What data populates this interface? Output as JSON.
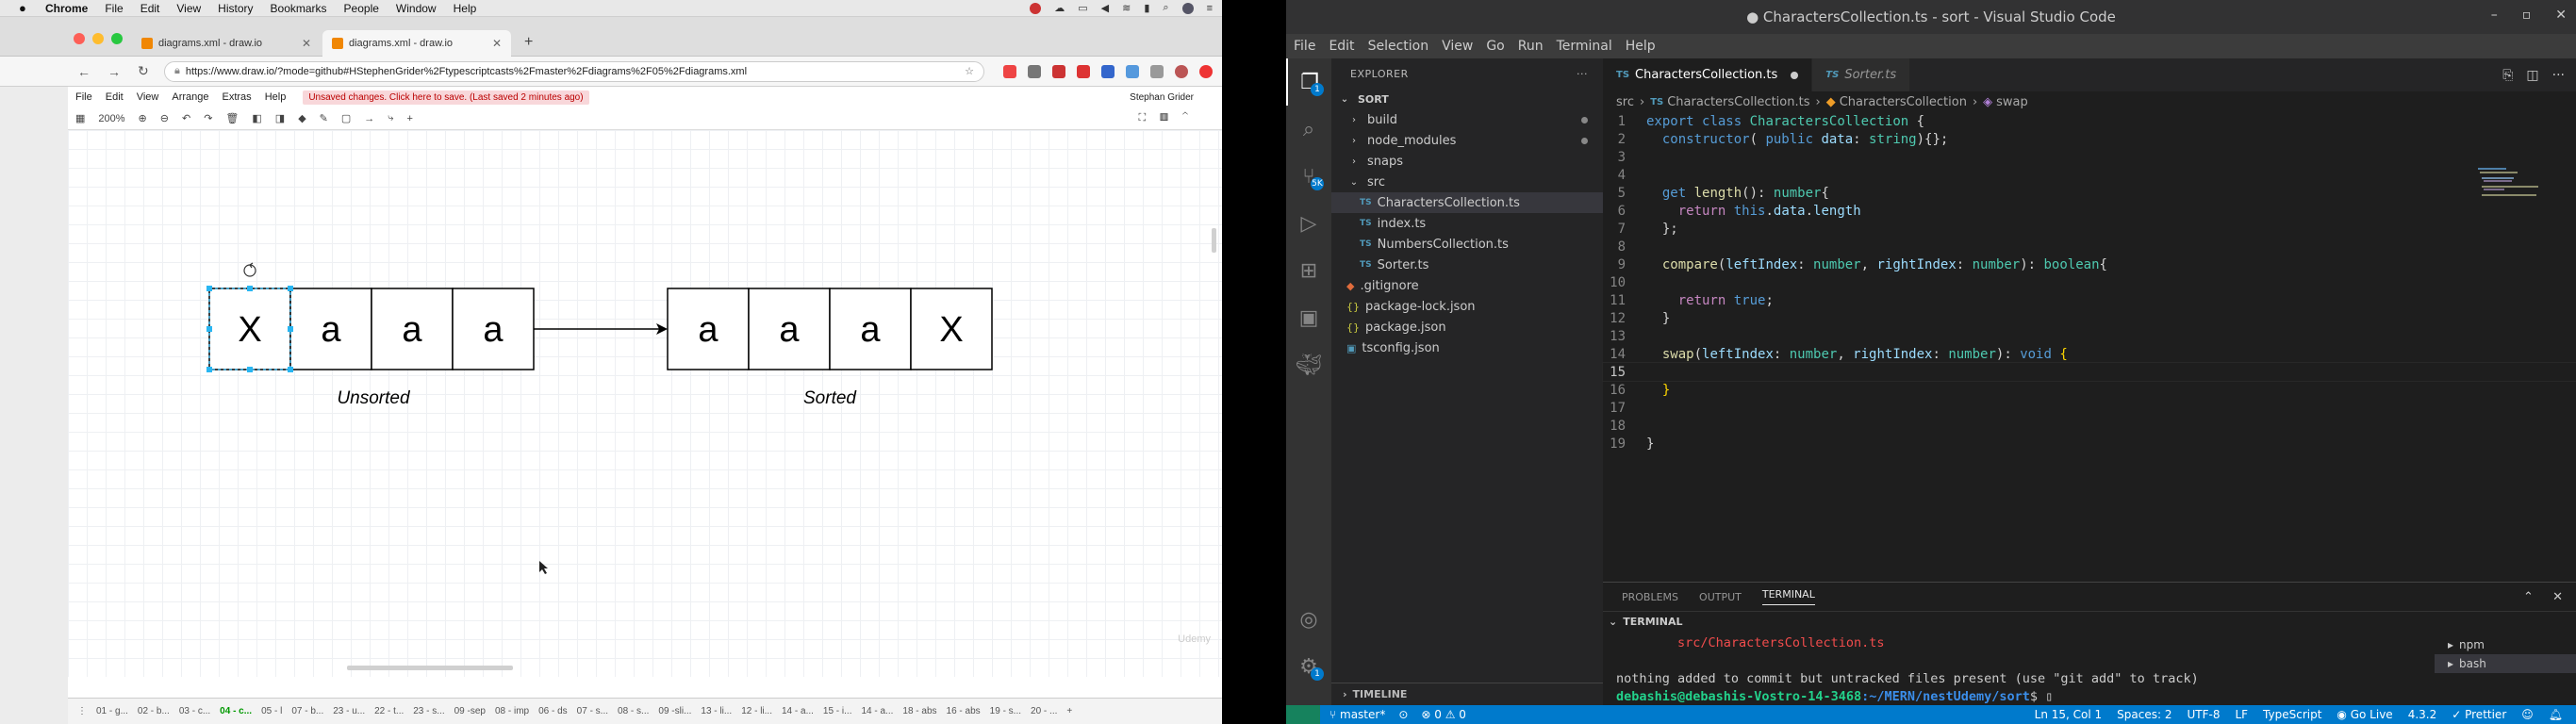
{
  "mac_menu": {
    "app": "Chrome",
    "items": [
      "File",
      "Edit",
      "View",
      "History",
      "Bookmarks",
      "People",
      "Window",
      "Help"
    ]
  },
  "chrome": {
    "tabs": [
      {
        "title": "diagrams.xml - draw.io"
      },
      {
        "title": "diagrams.xml - draw.io"
      }
    ],
    "new_tab": "+",
    "url": "https://www.draw.io/?mode=github#HStephenGrider%2Ftypescriptcasts%2Fmaster%2Fdiagrams%2F05%2Fdiagrams.xml"
  },
  "drawio": {
    "menus": [
      "File",
      "Edit",
      "View",
      "Arrange",
      "Extras",
      "Help"
    ],
    "unsaved": "Unsaved changes. Click here to save. (Last saved 2 minutes ago)",
    "user": "Stephan Grider",
    "zoom": "200%",
    "unsorted_cells": [
      "X",
      "a",
      "a",
      "a"
    ],
    "sorted_cells": [
      "a",
      "a",
      "a",
      "X"
    ],
    "unsorted_label": "Unsorted",
    "sorted_label": "Sorted",
    "watermark": "Udemy",
    "pages": [
      "01 - g...",
      "02 - b...",
      "03 - c...",
      "04 - c...",
      "05 - l",
      "07 - b...",
      "23 - u...",
      "22 - t...",
      "23 - s...",
      "09 -sep",
      "08 - imp",
      "06 - ds",
      "07 - s...",
      "08 - s...",
      "09 -sli...",
      "13 - li...",
      "12 - li...",
      "14 - a...",
      "15 - i...",
      "14 - a...",
      "18 - abs",
      "16 - abs",
      "19 - s...",
      "20 - ..."
    ],
    "active_page": "04 - c..."
  },
  "vscode": {
    "title": "● CharactersCollection.ts - sort - Visual Studio Code",
    "menu": [
      "File",
      "Edit",
      "Selection",
      "View",
      "Go",
      "Run",
      "Terminal",
      "Help"
    ],
    "explorer_title": "EXPLORER",
    "folder": "SORT",
    "tree": [
      {
        "name": "build",
        "kind": "folder",
        "indent": 0,
        "mark": true
      },
      {
        "name": "node_modules",
        "kind": "folder",
        "indent": 0,
        "mark": true
      },
      {
        "name": "snaps",
        "kind": "folder",
        "indent": 0,
        "mark": false
      },
      {
        "name": "src",
        "kind": "folder-open",
        "indent": 0,
        "mark": false
      },
      {
        "name": "CharactersCollection.ts",
        "kind": "ts",
        "indent": 1,
        "mark": false,
        "selected": true
      },
      {
        "name": "index.ts",
        "kind": "ts",
        "indent": 1,
        "mark": false
      },
      {
        "name": "NumbersCollection.ts",
        "kind": "ts",
        "indent": 1,
        "mark": false
      },
      {
        "name": "Sorter.ts",
        "kind": "ts",
        "indent": 1,
        "mark": false
      },
      {
        "name": ".gitignore",
        "kind": "git",
        "indent": 0,
        "mark": false
      },
      {
        "name": "package-lock.json",
        "kind": "json",
        "indent": 0,
        "mark": false
      },
      {
        "name": "package.json",
        "kind": "json",
        "indent": 0,
        "mark": false
      },
      {
        "name": "tsconfig.json",
        "kind": "cfg",
        "indent": 0,
        "mark": false
      }
    ],
    "timeline": "TIMELINE",
    "tabs": [
      {
        "label": "CharactersCollection.ts",
        "active": true,
        "modified": true
      },
      {
        "label": "Sorter.ts",
        "active": false,
        "modified": false
      }
    ],
    "breadcrumbs": [
      "src",
      "CharactersCollection.ts",
      "CharactersCollection",
      "swap"
    ],
    "current_line": 15,
    "panel_tabs": [
      "PROBLEMS",
      "OUTPUT",
      "TERMINAL"
    ],
    "active_panel_tab": "TERMINAL",
    "terminal_label": "TERMINAL",
    "terminal_lines": [
      {
        "text": "        src/CharactersCollection.ts",
        "cls": "red"
      },
      {
        "text": "",
        "cls": ""
      },
      {
        "text": "nothing added to commit but untracked files present (use \"git add\" to track)",
        "cls": ""
      }
    ],
    "prompt_user": "debashis@debashis-Vostro-14-3468",
    "prompt_path": ":~/MERN/nestUdemy/sort",
    "prompt_end": "$ ",
    "terminals": [
      "npm",
      "bash"
    ],
    "status_left": [
      "master*",
      "⊗ 0 ⚠ 0"
    ],
    "status_right": [
      "Ln 15, Col 1",
      "Spaces: 2",
      "UTF-8",
      "LF",
      "TypeScript",
      "Go Live",
      "4.3.2",
      "Prettier"
    ]
  }
}
